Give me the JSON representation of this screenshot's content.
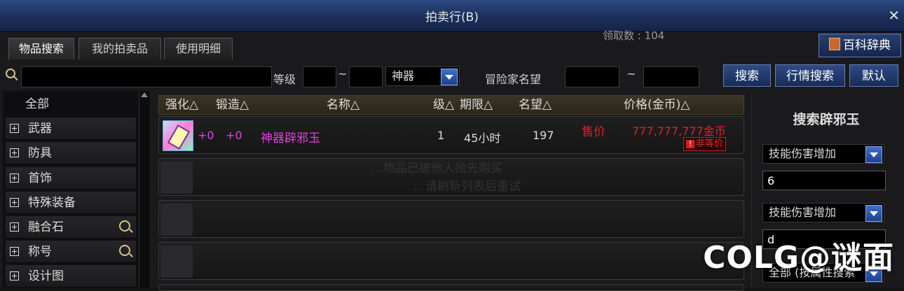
{
  "window": {
    "title": "拍卖行(B)"
  },
  "background_counter": "领取数 : 104",
  "tabs": [
    {
      "label": "物品搜索",
      "active": true
    },
    {
      "label": "我的拍卖品",
      "active": false
    },
    {
      "label": "使用明细",
      "active": false
    }
  ],
  "encyclopedia_label": "百科辞典",
  "search": {
    "query": "",
    "level_label": "等级",
    "level_from": "",
    "level_sep": "~",
    "level_to": "",
    "rarity_selected": "神器",
    "fame_label": "冒险家名望",
    "fame_from": "",
    "fame_sep": "~",
    "fame_to": "",
    "search_button": "搜索",
    "market_search_button": "行情搜索",
    "default_button": "默认"
  },
  "categories": [
    {
      "label": "全部",
      "expandable": false,
      "zoom": false
    },
    {
      "label": "武器",
      "expandable": true,
      "zoom": false
    },
    {
      "label": "防具",
      "expandable": true,
      "zoom": false
    },
    {
      "label": "首饰",
      "expandable": true,
      "zoom": false
    },
    {
      "label": "特殊装备",
      "expandable": true,
      "zoom": false
    },
    {
      "label": "融合石",
      "expandable": true,
      "zoom": true
    },
    {
      "label": "称号",
      "expandable": true,
      "zoom": true
    },
    {
      "label": "设计图",
      "expandable": true,
      "zoom": false
    }
  ],
  "columns": [
    "强化△",
    "锻造△",
    "名称△",
    "级△",
    "期限△",
    "名望△",
    "价格(金币)△"
  ],
  "listings": [
    {
      "enhance": "+0",
      "forge": "+0",
      "name": "神器辟邪玉",
      "level": "1",
      "duration": "45小时",
      "fame": "197",
      "sale_label": "售价",
      "price": "777,777,777金币",
      "badge": "非等价",
      "badge_icon": "!"
    }
  ],
  "empty_rows": 3,
  "background_text": [
    "…物品已被他人抢先购买",
    "…请刷新列表后重试"
  ],
  "right_panel": {
    "title": "搜索辟邪玉",
    "option1_selected": "技能伤害增加",
    "option1_value": "6",
    "option2_selected": "技能伤害增加",
    "option2_value": "d",
    "filter_selected": "全部 (按属性搜索"
  },
  "watermark": "COLG@谜面",
  "colors": {
    "accent_blue": "#2f4a86",
    "item_name": "#e23fe0",
    "price": "#e02020"
  }
}
